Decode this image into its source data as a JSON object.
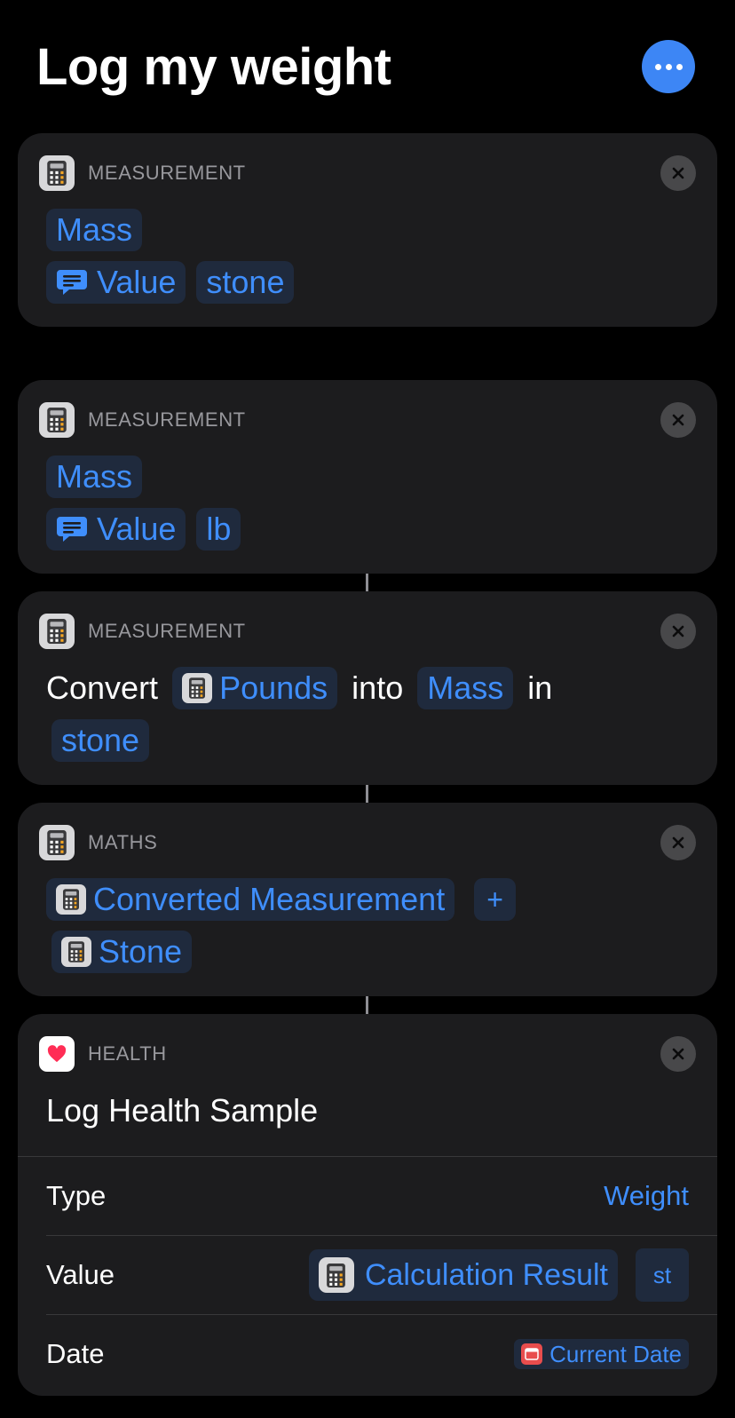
{
  "header": {
    "title": "Log my weight"
  },
  "colors": {
    "accent": "#3f8efc",
    "card": "#1c1c1e",
    "token_bg": "#1f2a3d"
  },
  "actions": [
    {
      "category": "MEASUREMENT",
      "line1": {
        "unit_type": "Mass"
      },
      "line2": {
        "value": "Value",
        "unit": "stone"
      }
    },
    {
      "category": "MEASUREMENT",
      "line1": {
        "unit_type": "Mass"
      },
      "line2": {
        "value": "Value",
        "unit": "lb"
      }
    },
    {
      "category": "MEASUREMENT",
      "text_convert": "Convert",
      "input": "Pounds",
      "text_into": "into",
      "unit_type": "Mass",
      "text_in": "in",
      "target_unit": "stone"
    },
    {
      "category": "MATHS",
      "operand1": "Converted Measurement",
      "operator": "+",
      "operand2": "Stone"
    },
    {
      "category": "HEALTH",
      "title": "Log Health Sample",
      "rows": {
        "type": {
          "label": "Type",
          "value": "Weight"
        },
        "value": {
          "label": "Value",
          "value": "Calculation Result",
          "unit": "st"
        },
        "date": {
          "label": "Date",
          "value": "Current Date"
        }
      }
    }
  ],
  "icons": {
    "more": "ellipsis-icon",
    "close": "close-icon",
    "calculator": "calculator-icon",
    "health": "heart-icon",
    "text": "text-bubble-icon",
    "date": "calendar-icon"
  }
}
